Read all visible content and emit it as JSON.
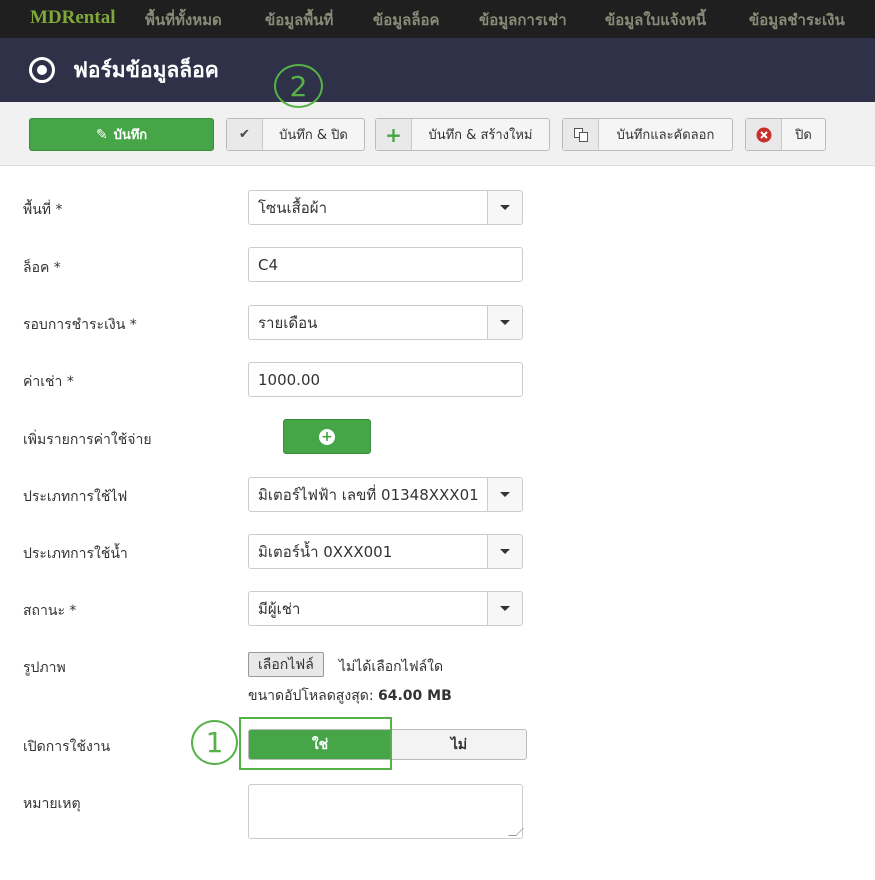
{
  "nav": {
    "brand": "MDRental",
    "items": [
      "พื้นที่ทั้งหมด",
      "ข้อมูลพื้นที่",
      "ข้อมูลล็อค",
      "ข้อมูลการเช่า",
      "ข้อมูลใบแจ้งหนี้",
      "ข้อมูลชำระเงิน"
    ]
  },
  "header": {
    "title": "ฟอร์มข้อมูลล็อค"
  },
  "toolbar": {
    "save": "บันทึก",
    "save_close": "บันทึก & ปิด",
    "save_new": "บันทึก & สร้างใหม่",
    "save_copy": "บันทึกและคัดลอก",
    "close": "ปิด"
  },
  "annotations": {
    "one": "1",
    "two": "2"
  },
  "form": {
    "area": {
      "label": "พื้นที่ *",
      "value": "โซนเสื้อผ้า"
    },
    "lock": {
      "label": "ล็อค *",
      "value": "C4"
    },
    "payment_cycle": {
      "label": "รอบการชำระเงิน *",
      "value": "รายเดือน"
    },
    "rent": {
      "label": "ค่าเช่า *",
      "value": "1000.00"
    },
    "add_expense": {
      "label": "เพิ่มรายการค่าใช้จ่าย"
    },
    "electric": {
      "label": "ประเภทการใช้ไฟ",
      "value": "มิเตอร์ไฟฟ้า เลขที่ 01348XXX01"
    },
    "water": {
      "label": "ประเภทการใช้น้ำ",
      "value": "มิเตอร์น้ำ 0XXX001"
    },
    "status": {
      "label": "สถานะ *",
      "value": "มีผู้เช่า"
    },
    "image": {
      "label": "รูปภาพ",
      "choose_file": "เลือกไฟล์",
      "no_file": "ไม่ได้เลือกไฟล์ใด",
      "max_upload_label": "ขนาดอัปโหลดสูงสุด:",
      "max_upload_value": "64.00 MB"
    },
    "enabled": {
      "label": "เปิดการใช้งาน",
      "yes": "ใช่",
      "no": "ไม่",
      "selected": "ใช่"
    },
    "note": {
      "label": "หมายเหตุ",
      "value": ""
    }
  },
  "colors": {
    "accent": "#46a546",
    "header_bg": "#2f3148",
    "nav_bg": "#1f1f1f",
    "annotation": "#55b148"
  }
}
